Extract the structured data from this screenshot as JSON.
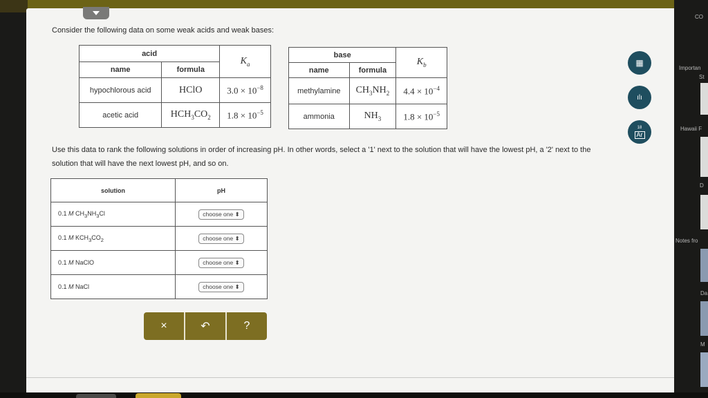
{
  "intro": "Consider the following data on some weak acids and weak bases:",
  "acid_table": {
    "group": "acid",
    "k_symbol": "K",
    "k_sub": "a",
    "col_name": "name",
    "col_formula": "formula",
    "rows": [
      {
        "name": "hypochlorous acid",
        "formula": "HClO",
        "coef": "3.0",
        "exp": "−8"
      },
      {
        "name": "acetic acid",
        "formula_main": "HCH",
        "formula_sub1": "3",
        "formula_mid": "CO",
        "formula_sub2": "2",
        "coef": "1.8",
        "exp": "−5"
      }
    ]
  },
  "base_table": {
    "group": "base",
    "k_symbol": "K",
    "k_sub": "b",
    "col_name": "name",
    "col_formula": "formula",
    "rows": [
      {
        "name": "methylamine",
        "formula_main": "CH",
        "formula_sub1": "3",
        "formula_mid": "NH",
        "formula_sub2": "2",
        "coef": "4.4",
        "exp": "−4"
      },
      {
        "name": "ammonia",
        "formula_main": "NH",
        "formula_sub1": "3",
        "coef": "1.8",
        "exp": "−5"
      }
    ]
  },
  "sci_times": "× 10",
  "instructions": "Use this data to rank the following solutions in order of increasing pH. In other words, select a '1' next to the solution that will have the lowest pH, a '2' next to the solution that will have the next lowest pH, and so on.",
  "solution_table": {
    "col_solution": "solution",
    "col_ph": "pH",
    "choose_label": "choose one",
    "rows": [
      {
        "conc": "0.1",
        "unit": "M",
        "f1": "CH",
        "s1": "3",
        "f2": "NH",
        "s2": "3",
        "f3": "Cl"
      },
      {
        "conc": "0.1",
        "unit": "M",
        "f1": "KCH",
        "s1": "3",
        "f2": "CO",
        "s2": "2",
        "f3": ""
      },
      {
        "conc": "0.1",
        "unit": "M",
        "f1": "NaClO",
        "s1": "",
        "f2": "",
        "s2": "",
        "f3": ""
      },
      {
        "conc": "0.1",
        "unit": "M",
        "f1": "NaCl",
        "s1": "",
        "f2": "",
        "s2": "",
        "f3": ""
      }
    ]
  },
  "buttons": {
    "clear": "×",
    "undo": "↶",
    "help": "?"
  },
  "side_icons": [
    {
      "name": "calculator-icon",
      "glyph": "▦"
    },
    {
      "name": "chart-icon",
      "glyph": "ılı"
    },
    {
      "name": "periodic-table-icon",
      "glyph": "Ar"
    }
  ],
  "periodic_number": "18",
  "right_panel": {
    "top": "CO",
    "important": "Importan",
    "st": "St",
    "hawaii": "Hawaii F",
    "d": "D",
    "notes": "Notes fro",
    "da": "Da",
    "m": "M"
  },
  "colors": {
    "accent": "#1f4e5f",
    "button_bar": "#7d6e22"
  }
}
